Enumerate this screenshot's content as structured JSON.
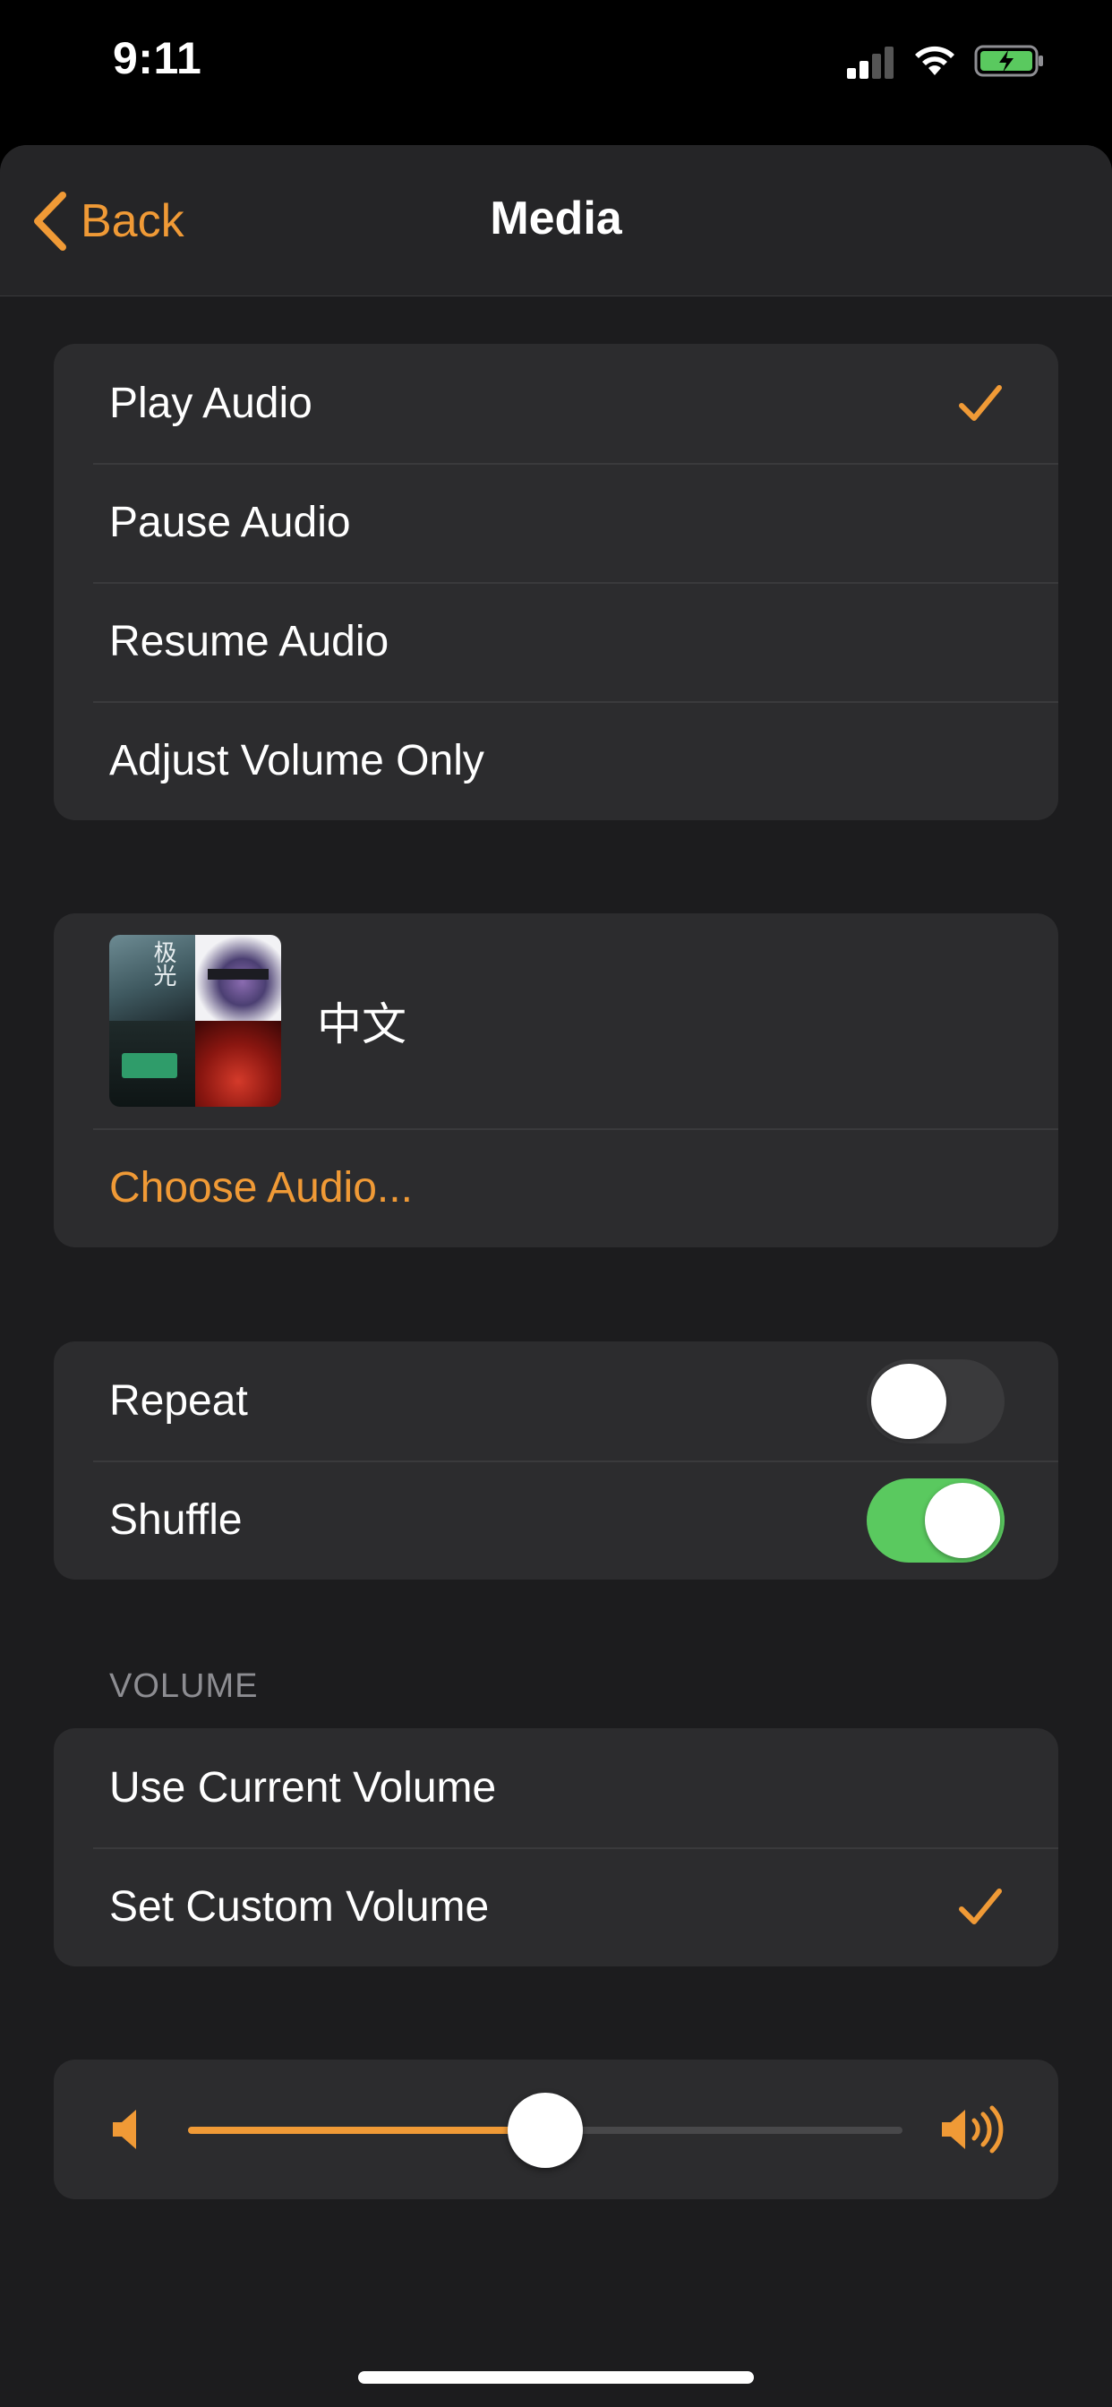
{
  "status_bar": {
    "time": "9:11"
  },
  "nav": {
    "back_label": "Back",
    "title": "Media"
  },
  "actions": {
    "items": [
      {
        "label": "Play Audio",
        "selected": true
      },
      {
        "label": "Pause Audio",
        "selected": false
      },
      {
        "label": "Resume Audio",
        "selected": false
      },
      {
        "label": "Adjust Volume Only",
        "selected": false
      }
    ]
  },
  "media": {
    "title": "中文",
    "choose_label": "Choose Audio..."
  },
  "playback": {
    "repeat": {
      "label": "Repeat",
      "on": false
    },
    "shuffle": {
      "label": "Shuffle",
      "on": true
    }
  },
  "volume": {
    "header": "VOLUME",
    "options": [
      {
        "label": "Use Current Volume",
        "selected": false
      },
      {
        "label": "Set Custom Volume",
        "selected": true
      }
    ],
    "level": 0.5
  },
  "colors": {
    "accent": "#f09a36",
    "toggle_on": "#5ac95f",
    "background": "#1c1c1e",
    "cell": "#2c2c2e"
  },
  "icons": {
    "back": "chevron-left-icon",
    "check": "checkmark-icon",
    "volume_low": "speaker-low-icon",
    "volume_high": "speaker-high-icon"
  }
}
